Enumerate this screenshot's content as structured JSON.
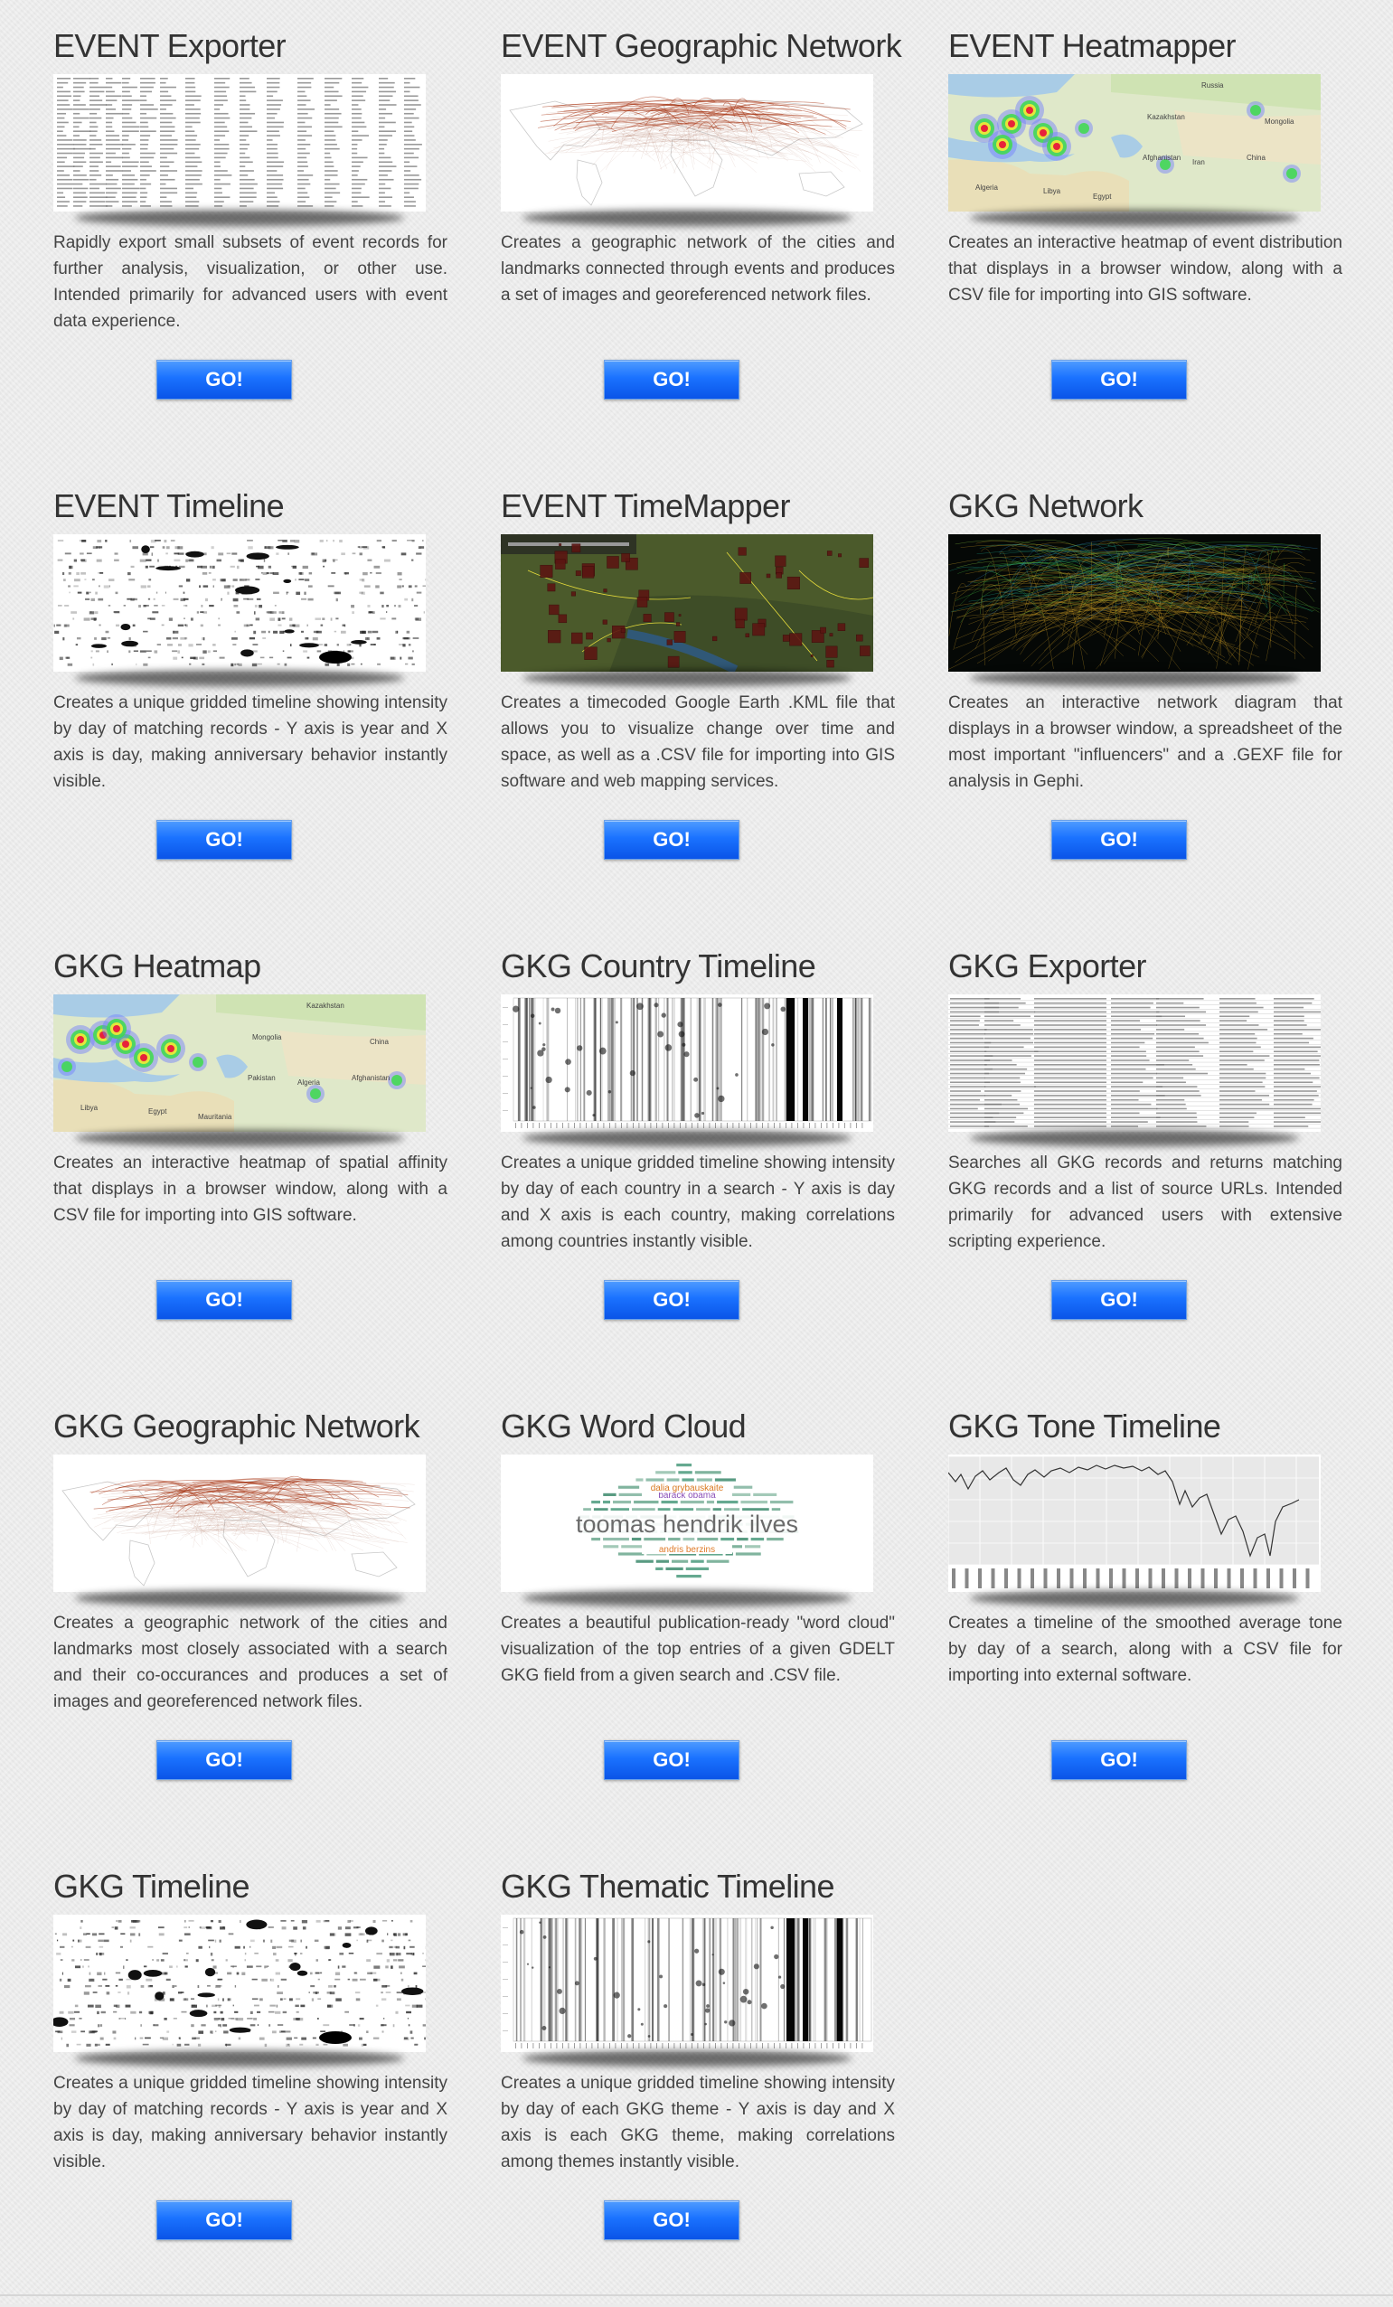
{
  "tools": [
    {
      "title": "EVENT Exporter",
      "description": "Rapidly export small subsets of event records for further analysis, visualization, or other use. Intended primarily for advanced users with event data experience.",
      "button": "GO!",
      "thumbnail": "spreadsheet-table"
    },
    {
      "title": "EVENT Geographic Network",
      "description": "Creates a geographic network of the cities and landmarks connected through events and produces a set of images and georeferenced network files.",
      "button": "GO!",
      "thumbnail": "world-network-map"
    },
    {
      "title": "EVENT Heatmapper",
      "description": "Creates an interactive heatmap of event distribution that displays in a browser window, along with a CSV file for importing into GIS software.",
      "button": "GO!",
      "thumbnail": "heatmap",
      "map_labels": [
        "Russia",
        "Kazakhstan",
        "Mongolia",
        "China",
        "Afghanistan",
        "Iran",
        "Algeria",
        "Libya",
        "Egypt"
      ]
    },
    {
      "title": "EVENT Timeline",
      "description": "Creates a unique gridded timeline showing intensity by day of matching records - Y axis is year and X axis is day, making anniversary behavior instantly visible.",
      "button": "GO!",
      "thumbnail": "gridded-timeline"
    },
    {
      "title": "EVENT TimeMapper",
      "description": "Creates a timecoded Google Earth .KML file that allows you to visualize change over time and space, as well as a .CSV file for importing into GIS software and web mapping services.",
      "button": "GO!",
      "thumbnail": "google-earth-map"
    },
    {
      "title": "GKG Network",
      "description": "Creates an interactive network diagram that displays in a browser window, a spreadsheet of the most important \"influencers\" and a .GEXF file for analysis in Gephi.",
      "button": "GO!",
      "thumbnail": "network-graph"
    },
    {
      "title": "GKG Heatmap",
      "description": "Creates an interactive heatmap of spatial affinity that displays in a browser window, along with a CSV file for importing into GIS software.",
      "button": "GO!",
      "thumbnail": "heatmap",
      "map_labels": [
        "Kazakhstan",
        "Mongolia",
        "China",
        "Afghanistan",
        "Pakistan",
        "Algeria",
        "Libya",
        "Egypt",
        "Mauritania"
      ]
    },
    {
      "title": "GKG Country Timeline",
      "description": "Creates a unique gridded timeline showing intensity by day of each country in a search - Y axis is day and X axis is each country, making correlations among countries instantly visible.",
      "button": "GO!",
      "thumbnail": "vertical-bar-timeline"
    },
    {
      "title": "GKG Exporter",
      "description": "Searches all GKG records and returns matching GKG records and a list of source URLs. Intended primarily for advanced users with extensive scripting experience.",
      "button": "GO!",
      "thumbnail": "spreadsheet-table-wide"
    },
    {
      "title": "GKG Geographic Network",
      "description": "Creates a geographic network of the cities and landmarks most closely associated with a search and their co-occurances and produces a set of images and georeferenced network files.",
      "button": "GO!",
      "thumbnail": "world-network-map"
    },
    {
      "title": "GKG Word Cloud",
      "description": "Creates a beautiful publication-ready \"word cloud\" visualization of the top entries of a given GDELT GKG field from a given search and .CSV file.",
      "button": "GO!",
      "thumbnail": "word-cloud",
      "cloud_words": [
        "toomas hendrik ilves",
        "barack obama",
        "andris berzins",
        "dalia grybauskaite",
        "vladimir putin",
        "angela merkel",
        "andrus ansip"
      ]
    },
    {
      "title": "GKG Tone Timeline",
      "description": "Creates a timeline of the smoothed average tone by day of a search, along with a CSV file for importing into external software.",
      "button": "GO!",
      "thumbnail": "tone-line-chart"
    },
    {
      "title": "GKG Timeline",
      "description": "Creates a unique gridded timeline showing intensity by day of matching records - Y axis is year and X axis is day, making anniversary behavior instantly visible.",
      "button": "GO!",
      "thumbnail": "gridded-timeline"
    },
    {
      "title": "GKG Thematic Timeline",
      "description": "Creates a unique gridded timeline showing intensity by day of each GKG theme - Y axis is day and X axis is each GKG theme, making correlations among themes instantly visible.",
      "button": "GO!",
      "thumbnail": "vertical-bar-timeline"
    }
  ]
}
